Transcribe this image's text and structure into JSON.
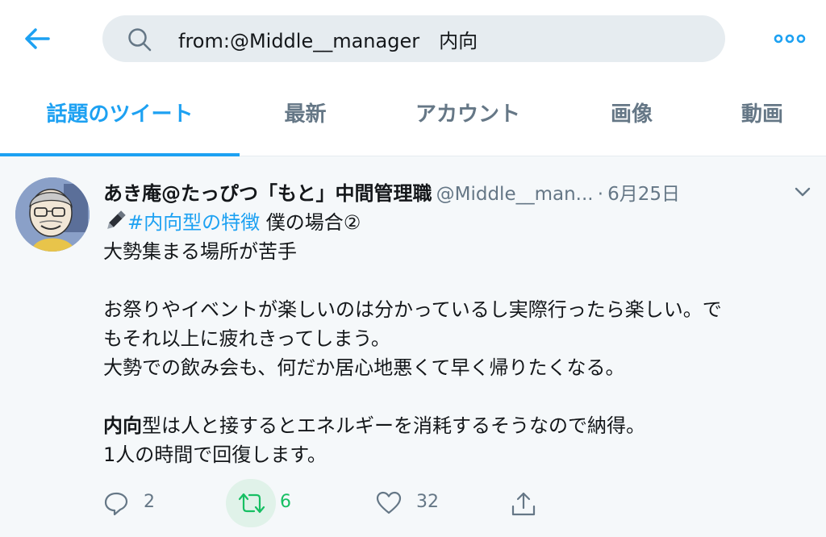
{
  "search": {
    "query": "from:@Middle__manager　内向"
  },
  "tabs": [
    {
      "label": "話題のツイート"
    },
    {
      "label": "最新"
    },
    {
      "label": "アカウント"
    },
    {
      "label": "画像"
    },
    {
      "label": "動画"
    }
  ],
  "tweet": {
    "display_name": "あき庵@たっぴつ「もと」中間管理職",
    "handle": "@Middle__man...",
    "separator": "·",
    "date": "6月25日",
    "hashtag": "#内向型の特徴",
    "line1_rest": " 僕の場合②",
    "line2": "大勢集まる場所が苦手",
    "line3": "お祭りやイベントが楽しいのは分かっているし実際行ったら楽しい。で",
    "line4": "もそれ以上に疲れきってしまう。",
    "line5": "大勢での飲み会も、何だか居心地悪くて早く帰りたくなる。",
    "line6_bold": "内向",
    "line6_rest": "型は人と接するとエネルギーを消耗するそうなので納得。",
    "line7": "1人の時間で回復します。"
  },
  "actions": {
    "reply_count": "2",
    "retweet_count": "6",
    "like_count": "32"
  },
  "colors": {
    "accent": "#1da1f2",
    "retweet": "#17bf63",
    "muted": "#657786",
    "text": "#14171a",
    "search_bg": "#e6ecf0",
    "tweet_bg": "#f5f8fa"
  },
  "icons": {
    "back": "arrow-left-icon",
    "search": "search-icon",
    "more": "more-dots-icon",
    "caret": "chevron-down-icon",
    "pen": "pen-icon",
    "reply": "reply-icon",
    "retweet": "retweet-icon",
    "like": "heart-icon",
    "share": "share-icon"
  }
}
